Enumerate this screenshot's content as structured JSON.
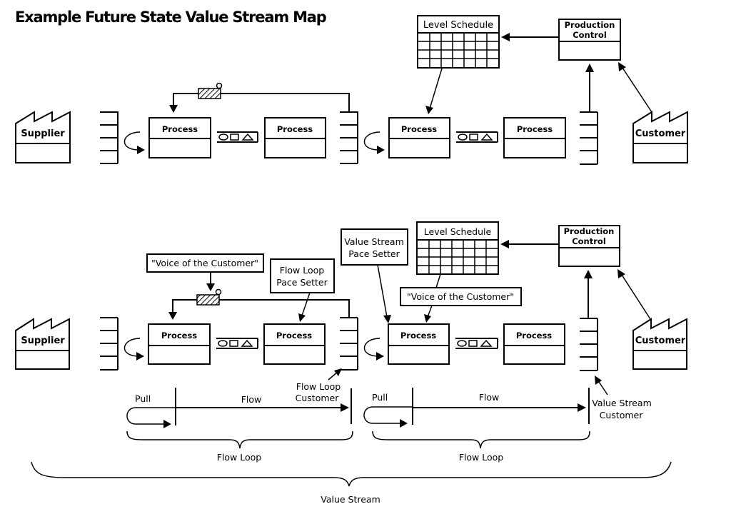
{
  "title": "Example Future State Value Stream Map",
  "top_map": {
    "supplier": "Supplier",
    "customer": "Customer",
    "process_1": "Process",
    "process_2": "Process",
    "process_3": "Process",
    "process_4": "Process",
    "level_schedule": "Level Schedule",
    "production_control_line1": "Production",
    "production_control_line2": "Control"
  },
  "bottom_map": {
    "supplier": "Supplier",
    "customer": "Customer",
    "process_1": "Process",
    "process_2": "Process",
    "process_3": "Process",
    "process_4": "Process",
    "level_schedule": "Level Schedule",
    "production_control_line1": "Production",
    "production_control_line2": "Control",
    "voice_of_customer_1": "\"Voice of the Customer\"",
    "voice_of_customer_2": "\"Voice of the Customer\"",
    "flow_loop_pace_setter_line1": "Flow Loop",
    "flow_loop_pace_setter_line2": "Pace Setter",
    "value_stream_pace_setter_line1": "Value Stream",
    "value_stream_pace_setter_line2": "Pace Setter",
    "flow_loop_customer_line1": "Flow Loop",
    "flow_loop_customer_line2": "Customer",
    "value_stream_customer_line1": "Value Stream",
    "value_stream_customer_line2": "Customer"
  },
  "legend_row": {
    "pull_1": "Pull",
    "flow_1": "Flow",
    "pull_2": "Pull",
    "flow_2": "Flow",
    "flow_loop_1": "Flow Loop",
    "flow_loop_2": "Flow Loop",
    "value_stream": "Value Stream"
  }
}
